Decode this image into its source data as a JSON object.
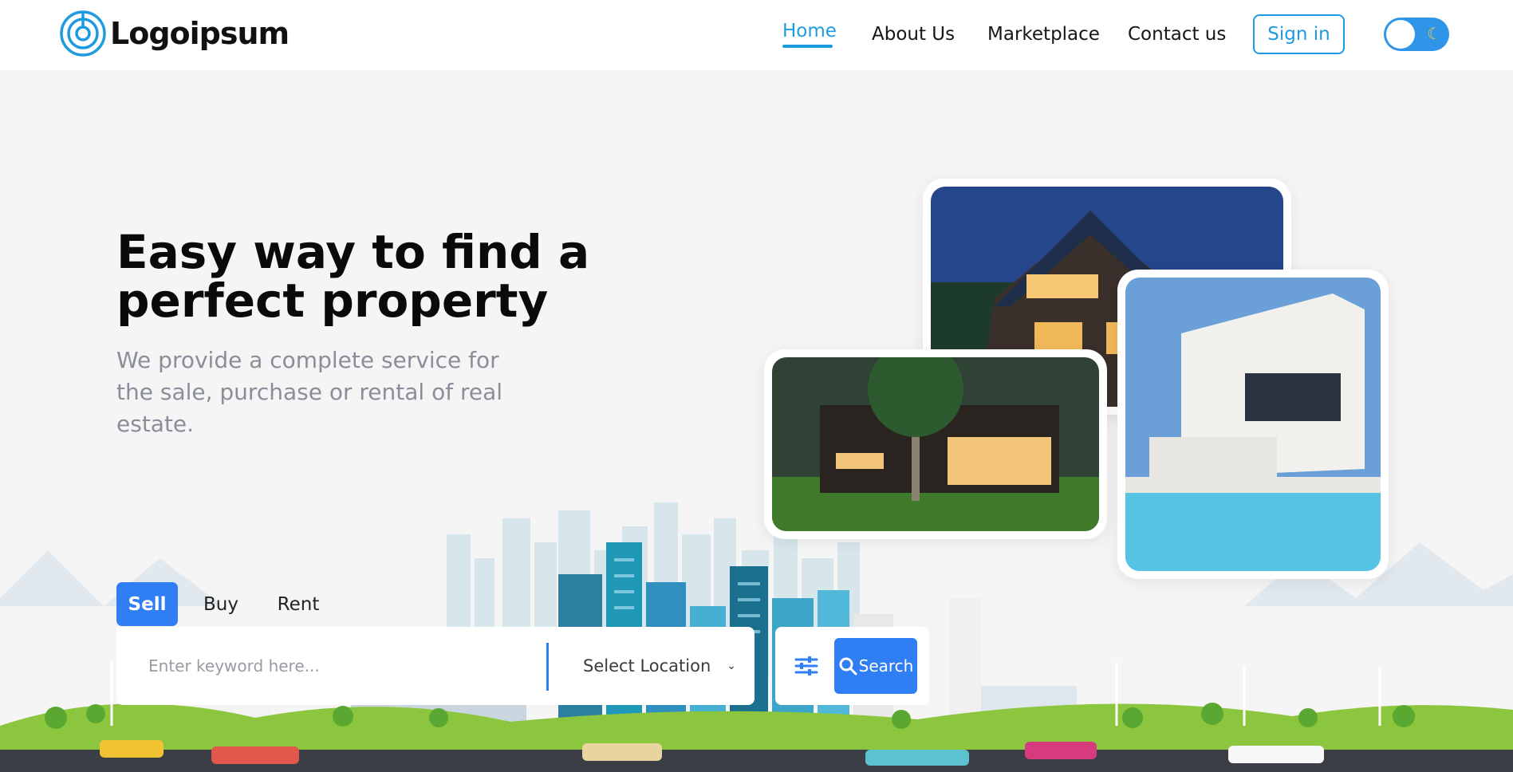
{
  "brand": {
    "name": "Logoipsum"
  },
  "nav": {
    "links": [
      "Home",
      "About Us",
      "Marketplace",
      "Contact us"
    ],
    "active": "Home",
    "signin_label": "Sign in",
    "theme_toggle_icon": "moon-icon"
  },
  "hero": {
    "title": "Easy way to find a perfect property",
    "subtitle": "We provide a complete service for the sale, purchase or rental of real estate."
  },
  "tabs": {
    "items": [
      "Sell",
      "Buy",
      "Rent"
    ],
    "active": "Sell"
  },
  "search": {
    "keyword_placeholder": "Enter keyword here...",
    "location_label": "Select Location",
    "filter_icon": "sliders-icon",
    "search_label": "Search",
    "search_icon": "search-icon"
  },
  "colors": {
    "accent": "#1e9be0",
    "primary": "#2f7ef3",
    "text": "#0a0a0a",
    "muted": "#8a8e99"
  },
  "images": [
    "house-evening-photo",
    "modern-house-tree-photo",
    "white-villa-pool-photo"
  ]
}
